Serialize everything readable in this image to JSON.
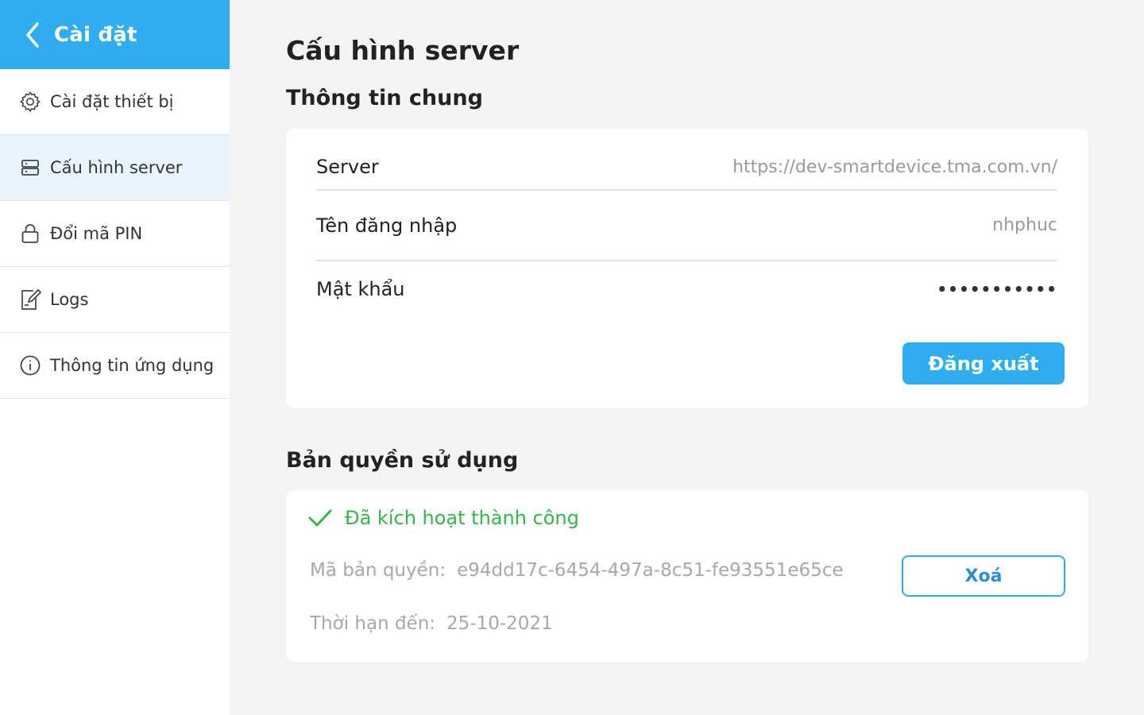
{
  "sidebar": {
    "header": {
      "title": "Cài đặt",
      "back_icon": "chevron-left-icon"
    },
    "items": [
      {
        "label": "Cài đặt thiết bị",
        "icon": "gear-icon",
        "active": false
      },
      {
        "label": "Cấu hình server",
        "icon": "server-icon",
        "active": true
      },
      {
        "label": "Đổi mã PIN",
        "icon": "lock-icon",
        "active": false
      },
      {
        "label": "Logs",
        "icon": "edit-document-icon",
        "active": false
      },
      {
        "label": "Thông tin ứng dụng",
        "icon": "info-icon",
        "active": false
      }
    ]
  },
  "main": {
    "title": "Cấu hình server",
    "general": {
      "title": "Thông tin chung",
      "fields": [
        {
          "label": "Server",
          "value": "https://dev-smartdevice.tma.com.vn/"
        },
        {
          "label": "Tên đăng nhập",
          "value": "nhphuc"
        },
        {
          "label": "Mật khẩu",
          "value": "•••••••••••"
        }
      ],
      "logout_label": "Đăng xuất"
    },
    "license": {
      "title": "Bản quyền sử dụng",
      "status": "Đã kích hoạt thành công",
      "status_icon": "check-icon",
      "key_label": "Mã bản quyền:",
      "key_value": "e94dd17c-6454-497a-8c51-fe93551e65ce",
      "expiry_label": "Thời hạn đến:",
      "expiry_value": "25-10-2021",
      "delete_label": "Xoá"
    }
  },
  "colors": {
    "accent": "#2eaef0",
    "success": "#36b54a",
    "active_bg": "#e8f5fd",
    "page_bg": "#f4f4f4"
  }
}
